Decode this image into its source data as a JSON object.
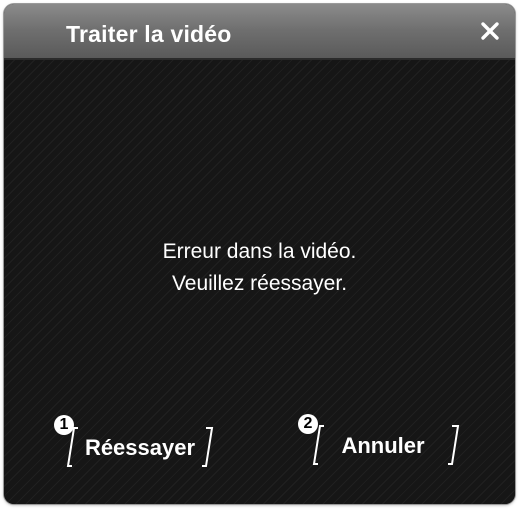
{
  "dialog": {
    "title": "Traiter la vidéo",
    "close_icon": "close-icon"
  },
  "message": {
    "line1": "Erreur dans la vidéo.",
    "line2": "Veuillez réessayer."
  },
  "buttons": {
    "retry_label": "Réessayer",
    "cancel_label": "Annuler",
    "retry_badge": "1",
    "cancel_badge": "2"
  },
  "colors": {
    "title_bar": "#6f6f6f",
    "background": "#1b1b1b",
    "text": "#ffffff"
  }
}
